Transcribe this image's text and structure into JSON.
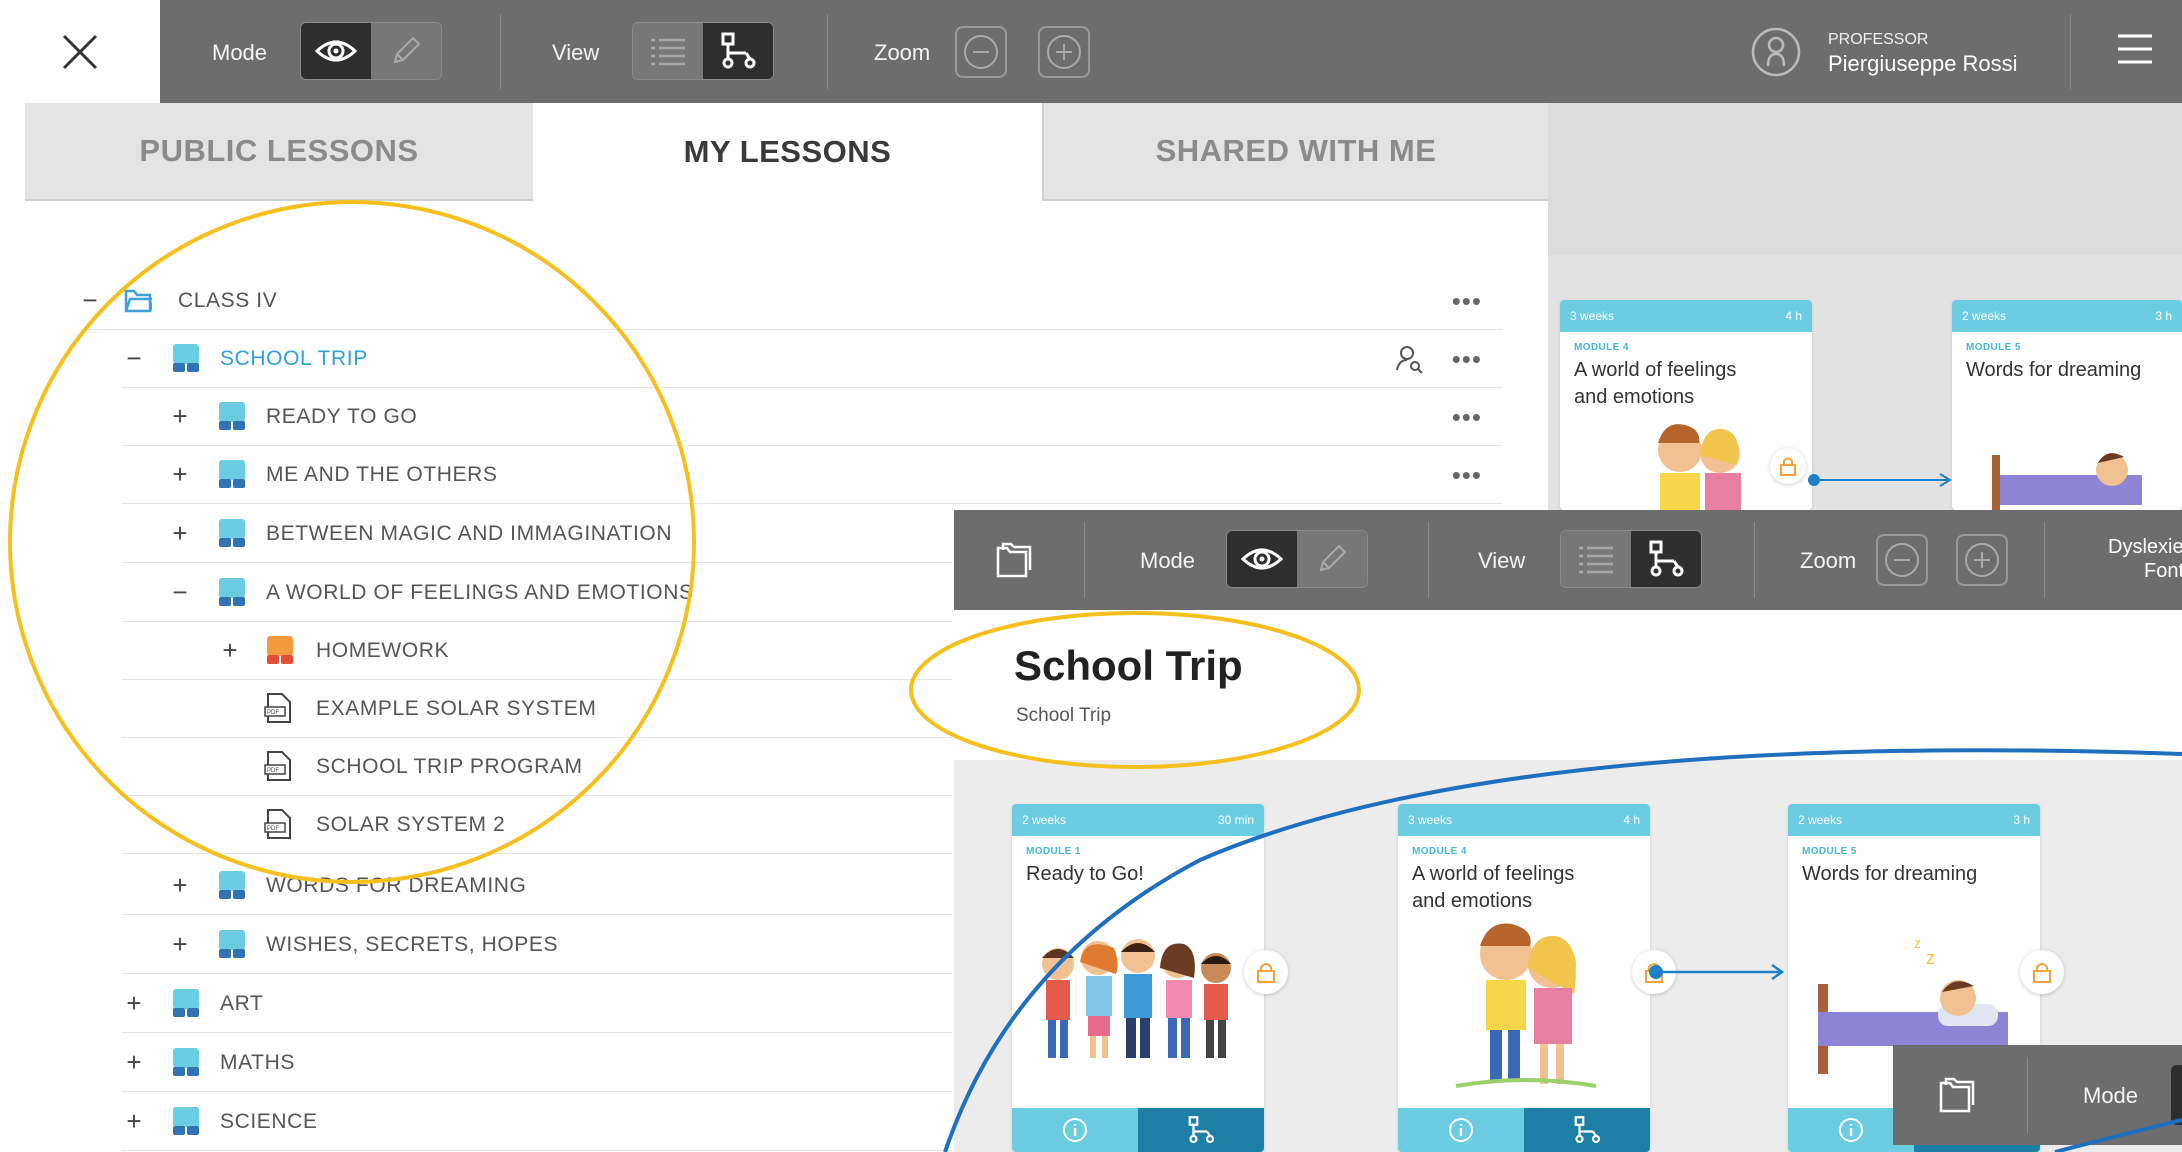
{
  "toolbar": {
    "mode_label": "Mode",
    "view_label": "View",
    "zoom_label": "Zoom",
    "user_role": "PROFESSOR",
    "user_name": "Piergiuseppe Rossi"
  },
  "tabs": [
    {
      "label": "PUBLIC LESSONS",
      "active": false
    },
    {
      "label": "MY LESSONS",
      "active": true
    },
    {
      "label": "SHARED WITH ME",
      "active": false
    }
  ],
  "tree": {
    "class": "CLASS IV",
    "school_trip": "SCHOOL TRIP",
    "ready_to_go": "READY TO GO",
    "me_and_others": "ME AND THE OTHERS",
    "between_magic": "BETWEEN MAGIC AND IMMAGINATION",
    "world_feelings": "A WORLD OF FEELINGS AND EMOTIONS",
    "homework": "HOMEWORK",
    "example_solar": "EXAMPLE SOLAR SYSTEM",
    "trip_program": "SCHOOL TRIP PROGRAM",
    "solar_2": "SOLAR SYSTEM 2",
    "words_dreaming": "WORDS FOR DREAMING",
    "wishes": "WISHES, SECRETS, HOPES",
    "art": "ART",
    "maths": "MATHS",
    "science": "SCIENCE"
  },
  "mid_toolbar": {
    "mode_label": "Mode",
    "view_label": "View",
    "zoom_label": "Zoom",
    "dyslexie_line1": "Dyslexie",
    "dyslexie_line2": "Font"
  },
  "lesson": {
    "title": "School Trip",
    "subtitle": "School Trip"
  },
  "cards_top": [
    {
      "duration": "3 weeks",
      "time": "4 h",
      "module": "MODULE 4",
      "title_l1": "A world of feelings",
      "title_l2": "and emotions"
    },
    {
      "duration": "2 weeks",
      "time": "3 h",
      "module": "MODULE 5",
      "title_l1": "Words for dreaming",
      "title_l2": ""
    }
  ],
  "cards_bottom": [
    {
      "duration": "2 weeks",
      "time": "30 min",
      "module": "MODULE 1",
      "title_l1": "Ready to Go!",
      "title_l2": ""
    },
    {
      "duration": "3 weeks",
      "time": "4 h",
      "module": "MODULE 4",
      "title_l1": "A world of feelings",
      "title_l2": "and emotions"
    },
    {
      "duration": "2 weeks",
      "time": "3 h",
      "module": "MODULE 5",
      "title_l1": "Words for dreaming",
      "title_l2": ""
    }
  ],
  "small_bar": {
    "mode_label": "Mode"
  },
  "colors": {
    "accent": "#49b7d3",
    "toolbar": "#6d6d6d",
    "highlight_circle": "#f5c01e",
    "curve": "#1f6fbf"
  }
}
